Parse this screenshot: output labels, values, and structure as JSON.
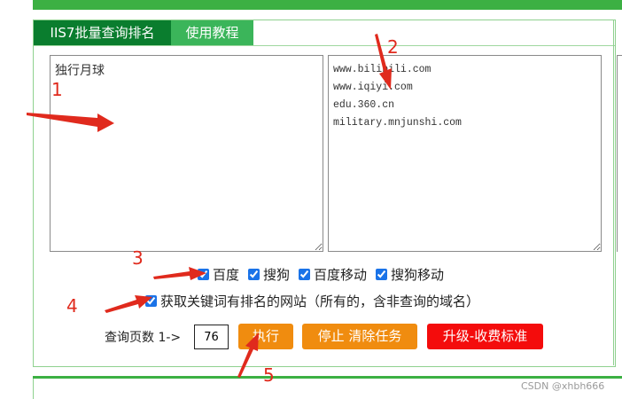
{
  "tabs": {
    "active": "IIS7批量查询排名",
    "tutorial": "使用教程"
  },
  "keywords_text": "独行月球",
  "domains_text": "www.bilibili.com\nwww.iqiyi.com\nedu.360.cn\nmilitary.mnjunshi.com",
  "engines": [
    {
      "label": "百度",
      "checked": true
    },
    {
      "label": "搜狗",
      "checked": true
    },
    {
      "label": "百度移动",
      "checked": true
    },
    {
      "label": "搜狗移动",
      "checked": true
    }
  ],
  "option_all_sites": {
    "label": "获取关键词有排名的网站（所有的，含非查询的域名）",
    "checked": true
  },
  "pages": {
    "label": "查询页数 1->",
    "value": "76"
  },
  "buttons": {
    "run": "执行",
    "stop": "停止 清除任务",
    "upgrade": "升级-收费标准"
  },
  "annotations": [
    "1",
    "2",
    "3",
    "4",
    "5"
  ],
  "colors": {
    "accent_green": "#3cb043",
    "dark_green": "#0a7d2e",
    "orange": "#f08c0f",
    "red": "#f40c0c",
    "annotation_red": "#e02a1d"
  },
  "watermark": "CSDN @xhbh666"
}
